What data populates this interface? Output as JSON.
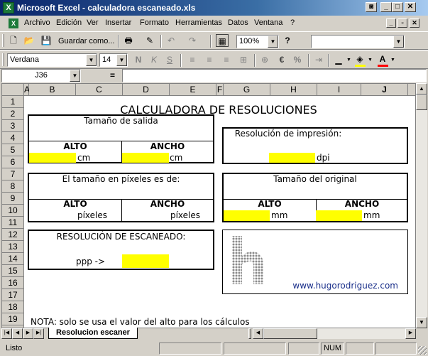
{
  "window": {
    "title": "Microsoft Excel - calculadora escaneado.xls",
    "app_icon": "X",
    "caption_buttons": [
      "◙",
      "_",
      "□",
      "✕"
    ]
  },
  "menu": {
    "items": [
      "Archivo",
      "Edición",
      "Ver",
      "Insertar",
      "Formato",
      "Herramientas",
      "Datos",
      "Ventana",
      "?"
    ],
    "doc_buttons": [
      "_",
      "▫",
      "✕"
    ]
  },
  "toolbar_standard": {
    "save_as_label": "Guardar como...",
    "zoom_value": "100%",
    "help_icon": "?"
  },
  "toolbar_format": {
    "font_name": "Verdana",
    "font_size": "14",
    "bold": "N",
    "italic": "K",
    "underline": "S",
    "currency": "€",
    "percent": "%"
  },
  "formula_bar": {
    "name_box": "J36",
    "equals": "=",
    "content": ""
  },
  "sheet": {
    "columns": [
      "A",
      "B",
      "C",
      "D",
      "E",
      "F",
      "G",
      "H",
      "I",
      "J"
    ],
    "rows": [
      "1",
      "2",
      "3",
      "4",
      "5",
      "6",
      "7",
      "8",
      "9",
      "10",
      "11",
      "12",
      "13",
      "14",
      "15",
      "16",
      "17",
      "18",
      "19",
      "20"
    ],
    "title": "CALCULADORA DE RESOLUCIONES",
    "output_size": {
      "heading": "Tamaño de salida",
      "alto_label": "ALTO",
      "ancho_label": "ANCHO",
      "alto_unit": "cm",
      "ancho_unit": "cm"
    },
    "print_resolution": {
      "heading": "Resolución de impresión:",
      "unit": "dpi"
    },
    "pixel_size": {
      "heading": "El tamaño en píxeles es de:",
      "alto_label": "ALTO",
      "ancho_label": "ANCHO",
      "alto_unit": "píxeles",
      "ancho_unit": "píxeles"
    },
    "original_size": {
      "heading": "Tamaño del original",
      "alto_label": "ALTO",
      "ancho_label": "ANCHO",
      "alto_unit": "mm",
      "ancho_unit": "mm"
    },
    "scan_resolution": {
      "heading": "RESOLUCIÓN DE ESCANEADO:",
      "ppp_label": "ppp ->"
    },
    "logo": {
      "letter": "h",
      "url": "www.hugorodriguez.com"
    },
    "note": "NOTA: solo se usa el valor del alto para los cálculos"
  },
  "tabs": {
    "active": "Resolucion escaner",
    "nav": [
      "|◀",
      "◀",
      "▶",
      "▶|"
    ]
  },
  "status": {
    "ready": "Listo",
    "num": "NUM"
  },
  "colors": {
    "title_bar": "#0a246a",
    "input_cell": "#ffff00",
    "excel_green": "#1d7a3a",
    "link_blue": "#1a2f8a"
  }
}
